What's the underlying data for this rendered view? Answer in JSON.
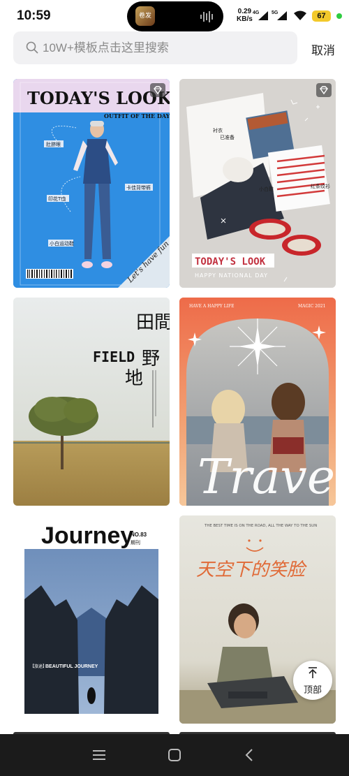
{
  "status": {
    "time": "10:59",
    "app_badge": "卷发",
    "speed_value": "0.29",
    "speed_unit": "KB/s",
    "signal_1": "4G",
    "signal_2": "5G",
    "battery": "67"
  },
  "search": {
    "placeholder": "10W+模板点击这里搜索",
    "cancel_label": "取消"
  },
  "cards": [
    {
      "title": "TODAY'S LOOK",
      "subtitle": "OUTFIT OF THE DAY",
      "tag1": "肚脐眼",
      "tag2": "卡佳背带裤",
      "tag3": "印花T恤",
      "tag4": "小白运动鞋",
      "corner": "Let's have fun",
      "vip": true
    },
    {
      "title": "TODAY'S LOOK",
      "subtitle": "HAPPY NATIONAL DAY",
      "note1": "衬衣",
      "note2": "已准备",
      "note3": "小白鞋",
      "note4": "红条纹衫",
      "vip": true
    },
    {
      "title_cn_1": "田間",
      "title_en": "FIELD",
      "title_cn_2": "野",
      "title_cn_3": "地"
    },
    {
      "top_left": "HAVE A HAPPY LIFE",
      "top_right": "MAGIC 2021",
      "title": "Travel"
    },
    {
      "title": "Journey",
      "issue": "NO.83",
      "issue_cn": "期刊",
      "caption": "BEAUTIFUL JOURNEY",
      "caption_cn": "【旅途】"
    },
    {
      "top_line": "THE BEST TIME IS ON THE ROAD, ALL THE WAY TO THE SUN",
      "title": "天空下的笑脸"
    }
  ],
  "back_to_top": {
    "label": "顶部"
  },
  "colors": {
    "accent_vip": "#ffffff",
    "battery": "#f3c92b",
    "online_dot": "#2ecc40",
    "travel_orange": "#f07a4e"
  }
}
